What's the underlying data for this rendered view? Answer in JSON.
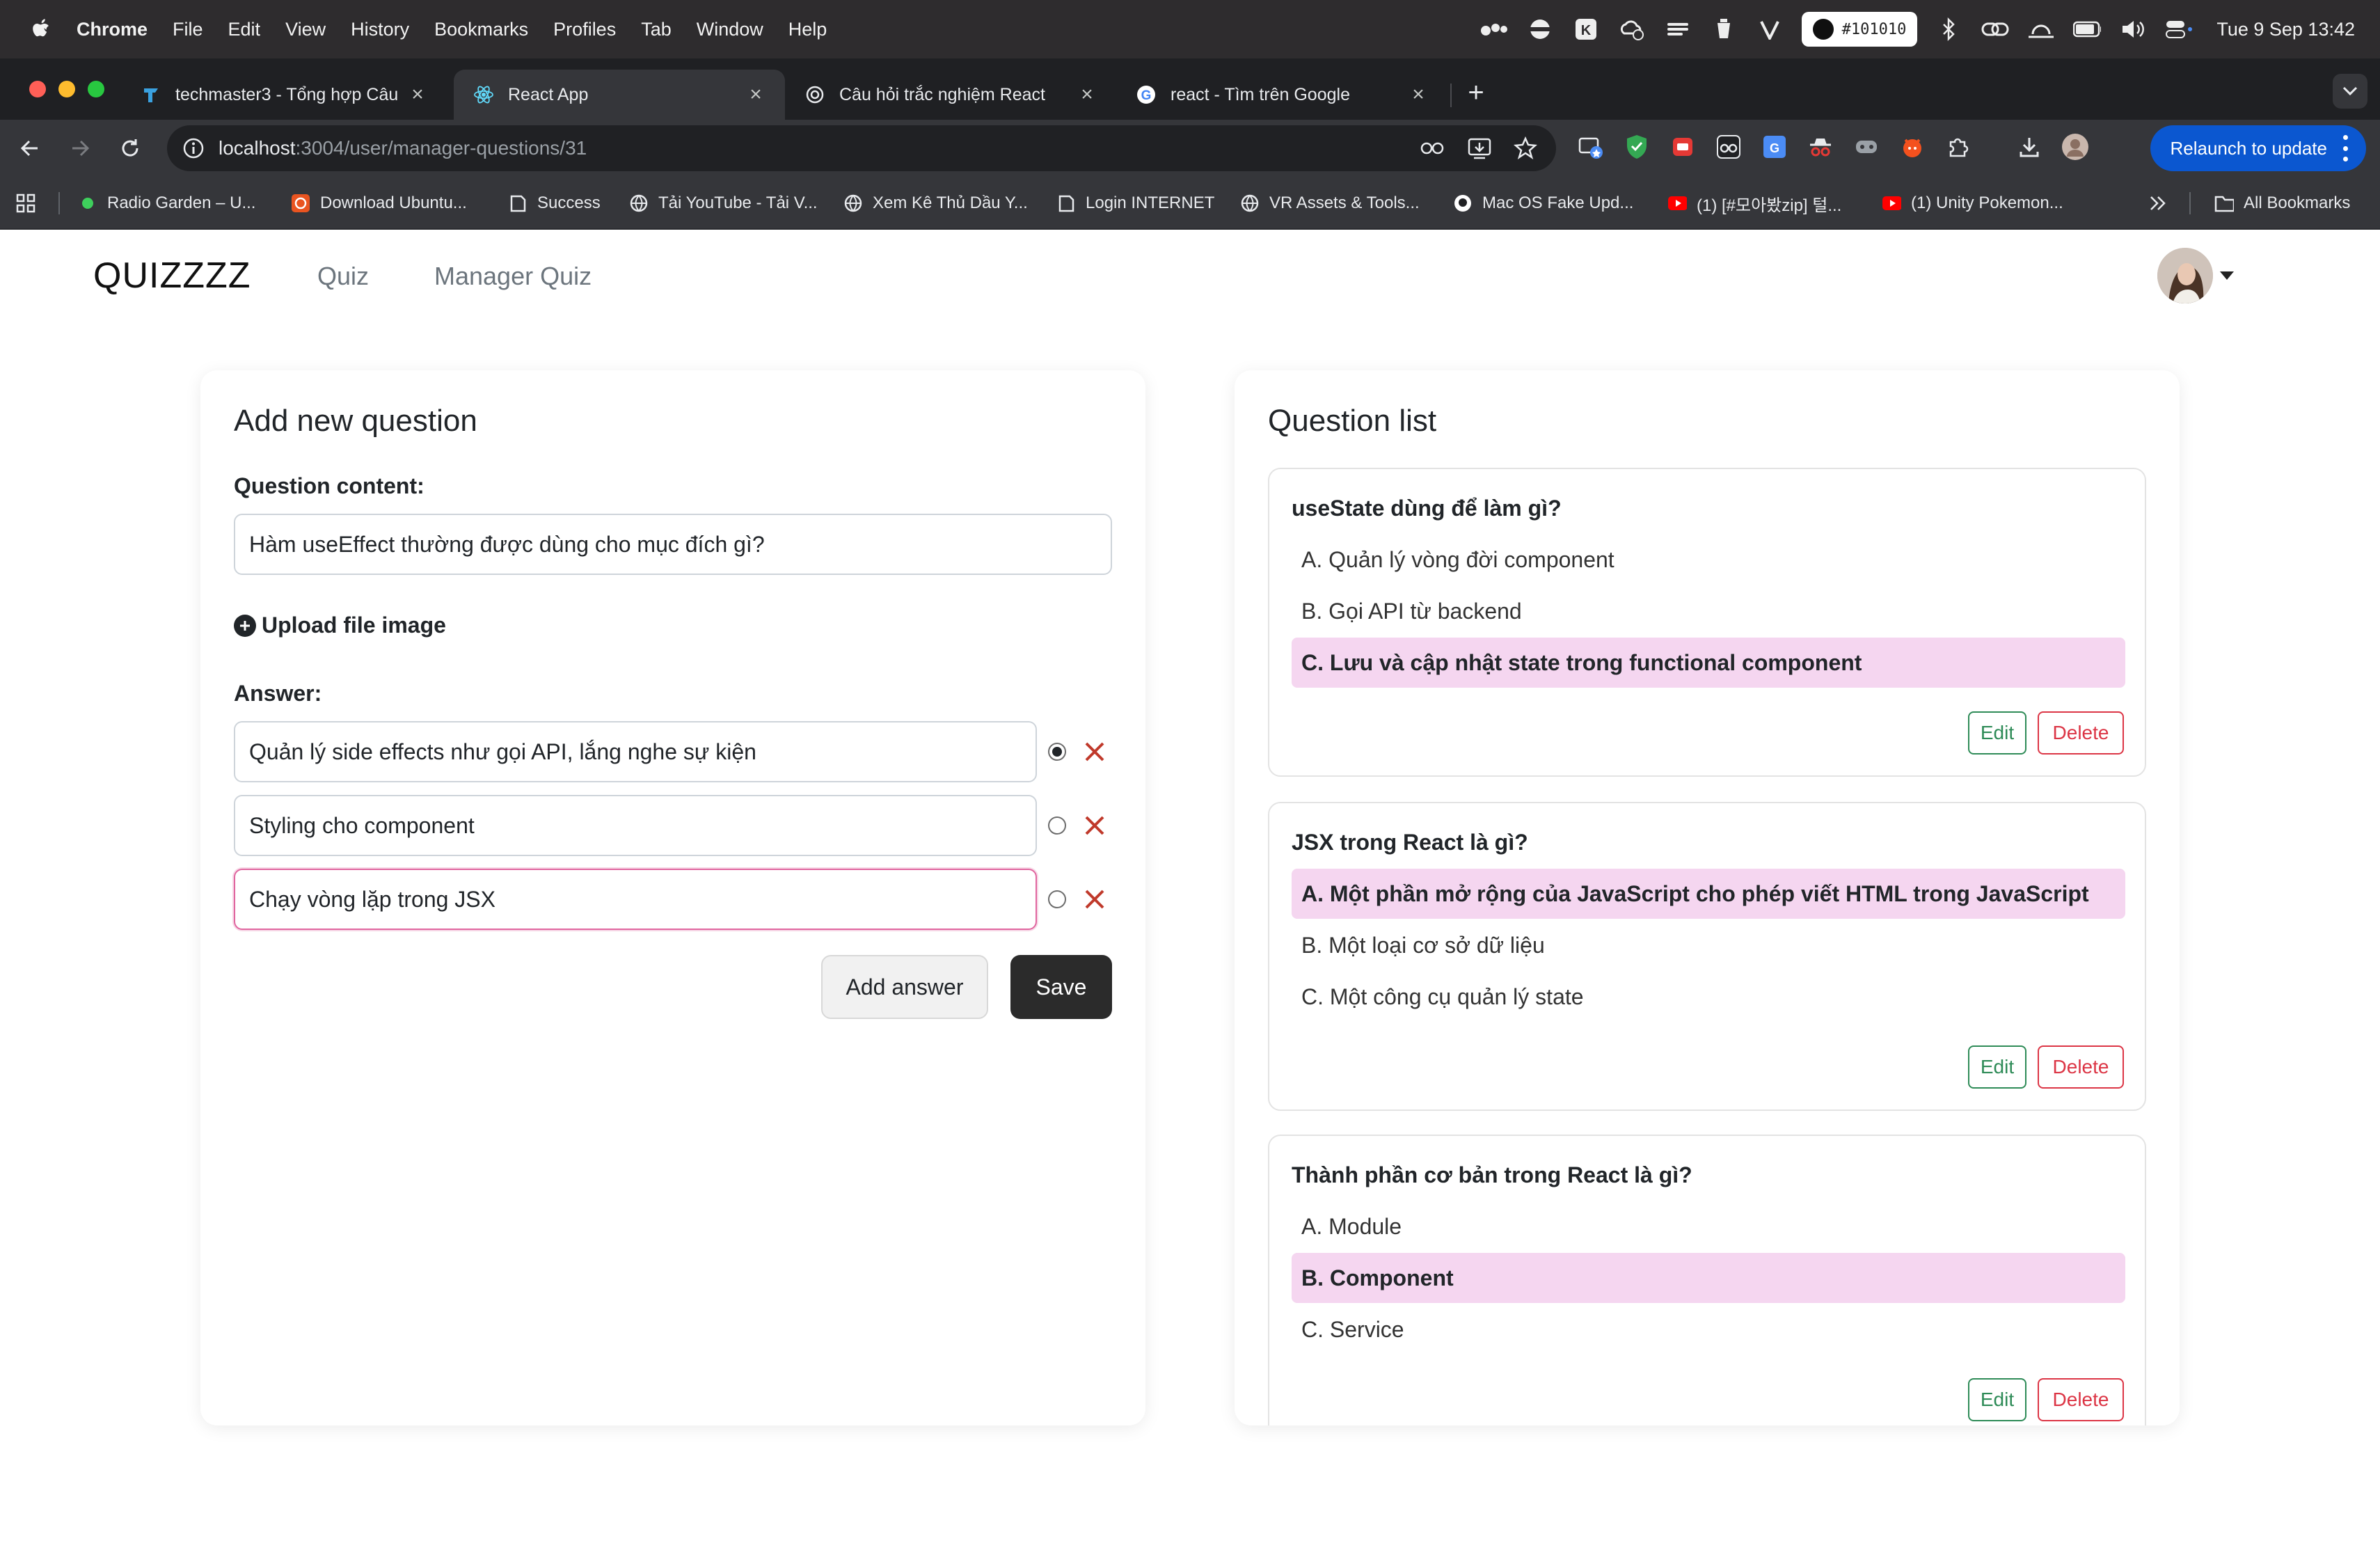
{
  "menubar": {
    "items": [
      "Chrome",
      "File",
      "Edit",
      "View",
      "History",
      "Bookmarks",
      "Profiles",
      "Tab",
      "Window",
      "Help"
    ],
    "color_hex": "#101010",
    "clock": "Tue 9 Sep  13:42"
  },
  "tabs": [
    {
      "title": "techmaster3 - Tổng hợp Câu",
      "icon": "techmaster-favicon"
    },
    {
      "title": "React App",
      "icon": "react-favicon"
    },
    {
      "title": "Câu hỏi trắc nghiệm React",
      "icon": "openai-favicon"
    },
    {
      "title": "react - Tìm trên Google",
      "icon": "google-favicon"
    }
  ],
  "toolbar": {
    "url_host": "localhost",
    "url_path": ":3004/user/manager-questions/31",
    "relaunch_label": "Relaunch to update"
  },
  "bookmarks": [
    {
      "label": "Radio Garden – U...",
      "icon": "green-dot-icon"
    },
    {
      "label": "Download Ubuntu...",
      "icon": "ubuntu-icon"
    },
    {
      "label": "Success",
      "icon": "page-icon"
    },
    {
      "label": "Tải YouTube - Tải V...",
      "icon": "globe-icon"
    },
    {
      "label": "Xem Kê Thủ Dầu Y...",
      "icon": "globe-icon"
    },
    {
      "label": "Login INTERNET",
      "icon": "page-icon"
    },
    {
      "label": "VR Assets & Tools...",
      "icon": "globe-icon"
    },
    {
      "label": "Mac OS Fake Upd...",
      "icon": "github-icon"
    },
    {
      "label": "(1) [#모아봤zip] 털...",
      "icon": "youtube-icon"
    },
    {
      "label": "(1) Unity Pokemon...",
      "icon": "youtube-icon"
    }
  ],
  "all_bookmarks_label": "All Bookmarks",
  "app": {
    "brand": "QUIZZZZ",
    "nav": [
      "Quiz",
      "Manager Quiz"
    ]
  },
  "form": {
    "title": "Add new question",
    "question_label": "Question content:",
    "question_value": "Hàm useEffect thường được dùng cho mục đích gì?",
    "upload_label": "Upload file image",
    "answer_label": "Answer:",
    "answers": [
      {
        "value": "Quản lý side effects như gọi API, lắng nghe sự kiện",
        "selected": true
      },
      {
        "value": "Styling cho component",
        "selected": false
      },
      {
        "value": "Chạy vòng lặp trong JSX",
        "selected": false
      }
    ],
    "add_answer_label": "Add answer",
    "save_label": "Save"
  },
  "list": {
    "title": "Question list",
    "edit_label": "Edit",
    "delete_label": "Delete",
    "questions": [
      {
        "question": "useState dùng để làm gì?",
        "options": [
          "A. Quản lý vòng đời component",
          "B. Gọi API từ backend",
          "C. Lưu và cập nhật state trong functional component"
        ],
        "correct_index": 2
      },
      {
        "question": "JSX trong React là gì?",
        "options": [
          "A. Một phần mở rộng của JavaScript cho phép viết HTML trong JavaScript",
          "B. Một loại cơ sở dữ liệu",
          "C. Một công cụ quản lý state"
        ],
        "correct_index": 0
      },
      {
        "question": "Thành phần cơ bản trong React là gì?",
        "options": [
          "A. Module",
          "B. Component",
          "C. Service"
        ],
        "correct_index": 1
      }
    ]
  },
  "colors": {
    "accent_pink": "#f5d6f0",
    "focus_border": "#e0669f",
    "edit_green": "#2e8b57",
    "delete_red": "#dc3545",
    "chrome_blue": "#0b57d0"
  }
}
